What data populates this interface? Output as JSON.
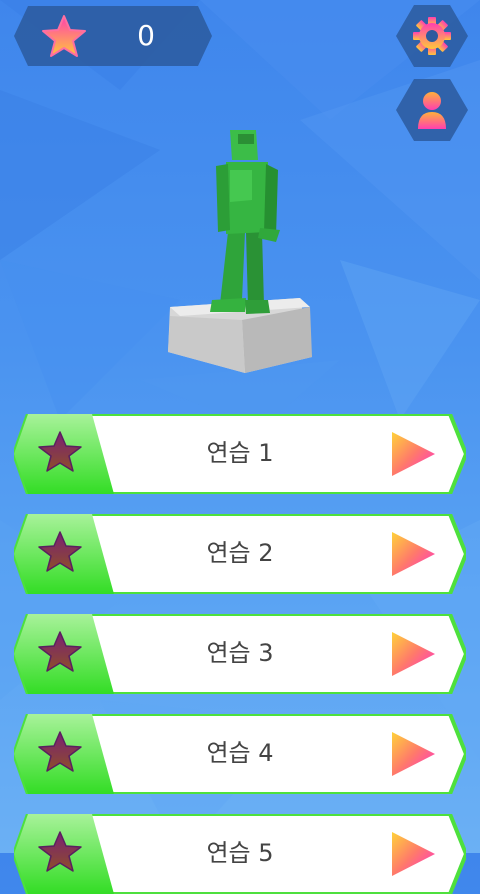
{
  "score": {
    "icon": "star-icon",
    "value": "0"
  },
  "top_buttons": [
    {
      "name": "settings-button",
      "icon": "gear-icon"
    },
    {
      "name": "profile-button",
      "icon": "person-icon"
    }
  ],
  "levels": [
    {
      "label": "연습 1",
      "icon": "star-icon",
      "play_icon": "play-icon"
    },
    {
      "label": "연습 2",
      "icon": "star-icon",
      "play_icon": "play-icon"
    },
    {
      "label": "연습 3",
      "icon": "star-icon",
      "play_icon": "play-icon"
    },
    {
      "label": "연습 4",
      "icon": "star-icon",
      "play_icon": "play-icon"
    },
    {
      "label": "연습 5",
      "icon": "star-icon",
      "play_icon": "play-icon"
    }
  ],
  "colors": {
    "background": "#4a93f0",
    "hud": "#2c5a9e",
    "accent_green": "#3ee030",
    "star_gradient": [
      "#ff3fb0",
      "#ffc73b"
    ],
    "locked_star": [
      "#6b1f6e",
      "#8a4a2a"
    ]
  }
}
